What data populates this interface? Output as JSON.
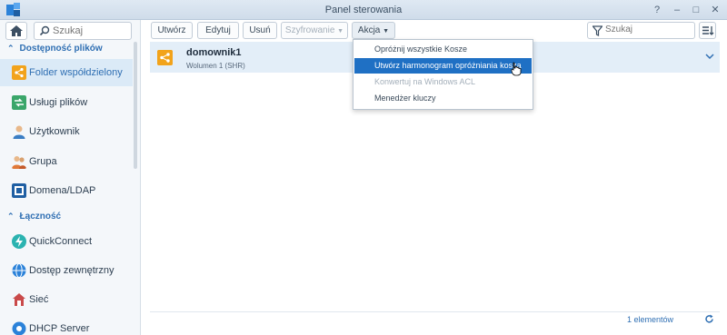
{
  "window": {
    "title": "Panel sterowania",
    "controls": [
      "?",
      "–",
      "□",
      "✕"
    ]
  },
  "sidebar": {
    "search_placeholder": "Szukaj",
    "sections": [
      {
        "title": "Dostępność plików"
      },
      {
        "title": "Łączność"
      }
    ],
    "items": [
      {
        "label": "Folder współdzielony",
        "icon": "shared-folder-icon",
        "color": "#f2a31b"
      },
      {
        "label": "Usługi plików",
        "icon": "file-services-icon",
        "color": "#3aa66a"
      },
      {
        "label": "Użytkownik",
        "icon": "user-icon",
        "color": "#3b7ec4"
      },
      {
        "label": "Grupa",
        "icon": "group-icon",
        "color": "#e07a3a"
      },
      {
        "label": "Domena/LDAP",
        "icon": "domain-icon",
        "color": "#1f5fa3"
      },
      {
        "label": "QuickConnect",
        "icon": "quickconnect-icon",
        "color": "#2bb3b0"
      },
      {
        "label": "Dostęp zewnętrzny",
        "icon": "external-access-icon",
        "color": "#2b82d9"
      },
      {
        "label": "Sieć",
        "icon": "network-icon",
        "color": "#c94a4a"
      },
      {
        "label": "DHCP Server",
        "icon": "dhcp-icon",
        "color": "#2b82d9"
      }
    ]
  },
  "toolbar": {
    "create": "Utwórz",
    "edit": "Edytuj",
    "delete": "Usuń",
    "encryption": "Szyfrowanie",
    "action": "Akcja",
    "search_placeholder": "Szukaj"
  },
  "action_menu": {
    "items": [
      {
        "label": "Opróżnij wszystkie Kosze",
        "state": "normal"
      },
      {
        "label": "Utwórz harmonogram opróżniania kosza",
        "state": "highlighted"
      },
      {
        "label": "Konwertuj na Windows ACL",
        "state": "disabled"
      },
      {
        "label": "Menedżer kluczy",
        "state": "normal"
      }
    ]
  },
  "folders": [
    {
      "name": "domownik1",
      "volume": "Wolumen 1 (SHR)"
    }
  ],
  "footer": {
    "count": "1 elementów"
  },
  "colors": {
    "accent": "#2f6fb3",
    "highlight": "#1f70c4",
    "selected_row": "#e3eef8"
  }
}
